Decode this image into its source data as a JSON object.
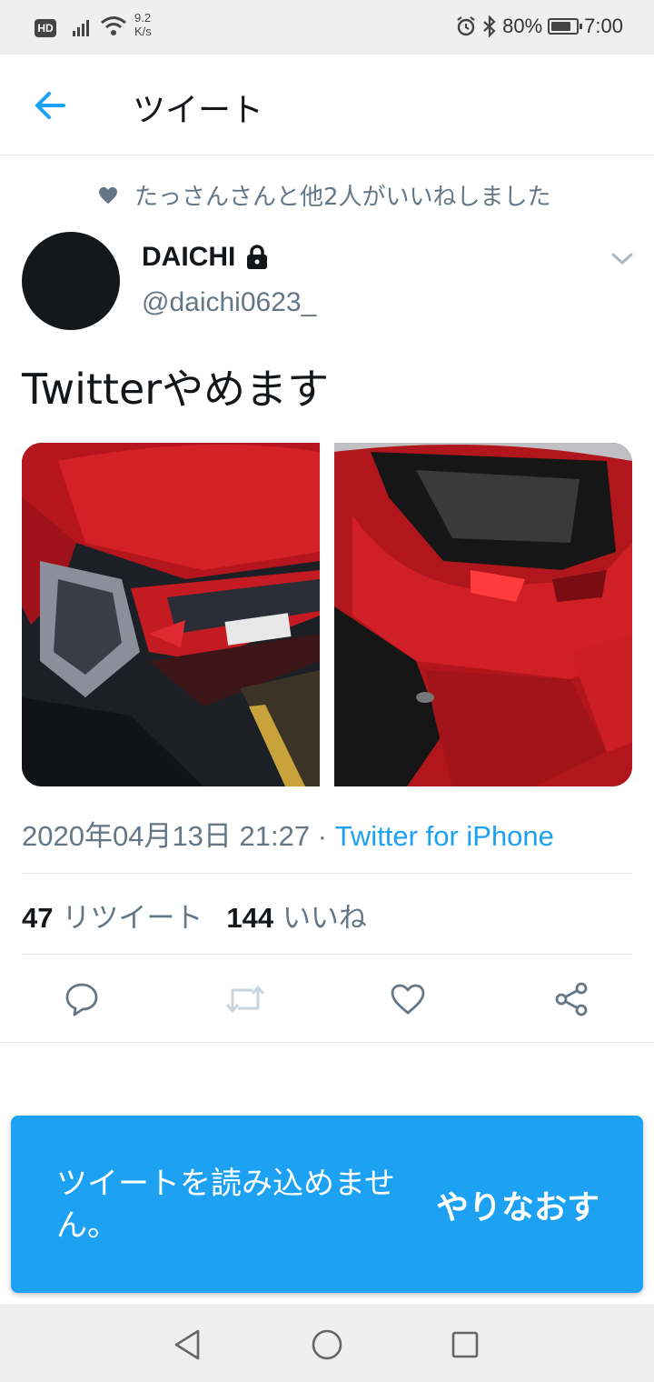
{
  "status_bar": {
    "hd": "HD",
    "speed_value": "9.2",
    "speed_unit": "K/s",
    "battery": "80%",
    "battery_level": 0.8,
    "time": "7:00"
  },
  "header": {
    "title": "ツイート"
  },
  "tweet": {
    "liked_by": "たっさんさんと他2人がいいねしました",
    "author_name": "DAICHI",
    "handle": "@daichi0623_",
    "text": "Twitterやめます",
    "date": "2020年04月13日 21:27",
    "separator": " · ",
    "source": "Twitter for iPhone",
    "retweet_count": "47",
    "retweet_label": "リツイート",
    "like_count": "144",
    "like_label": "いいね"
  },
  "toast": {
    "message": "ツイートを読み込めません。",
    "action": "やりなおす"
  },
  "colors": {
    "accent": "#1da1f2",
    "secondary_text": "#657786"
  }
}
